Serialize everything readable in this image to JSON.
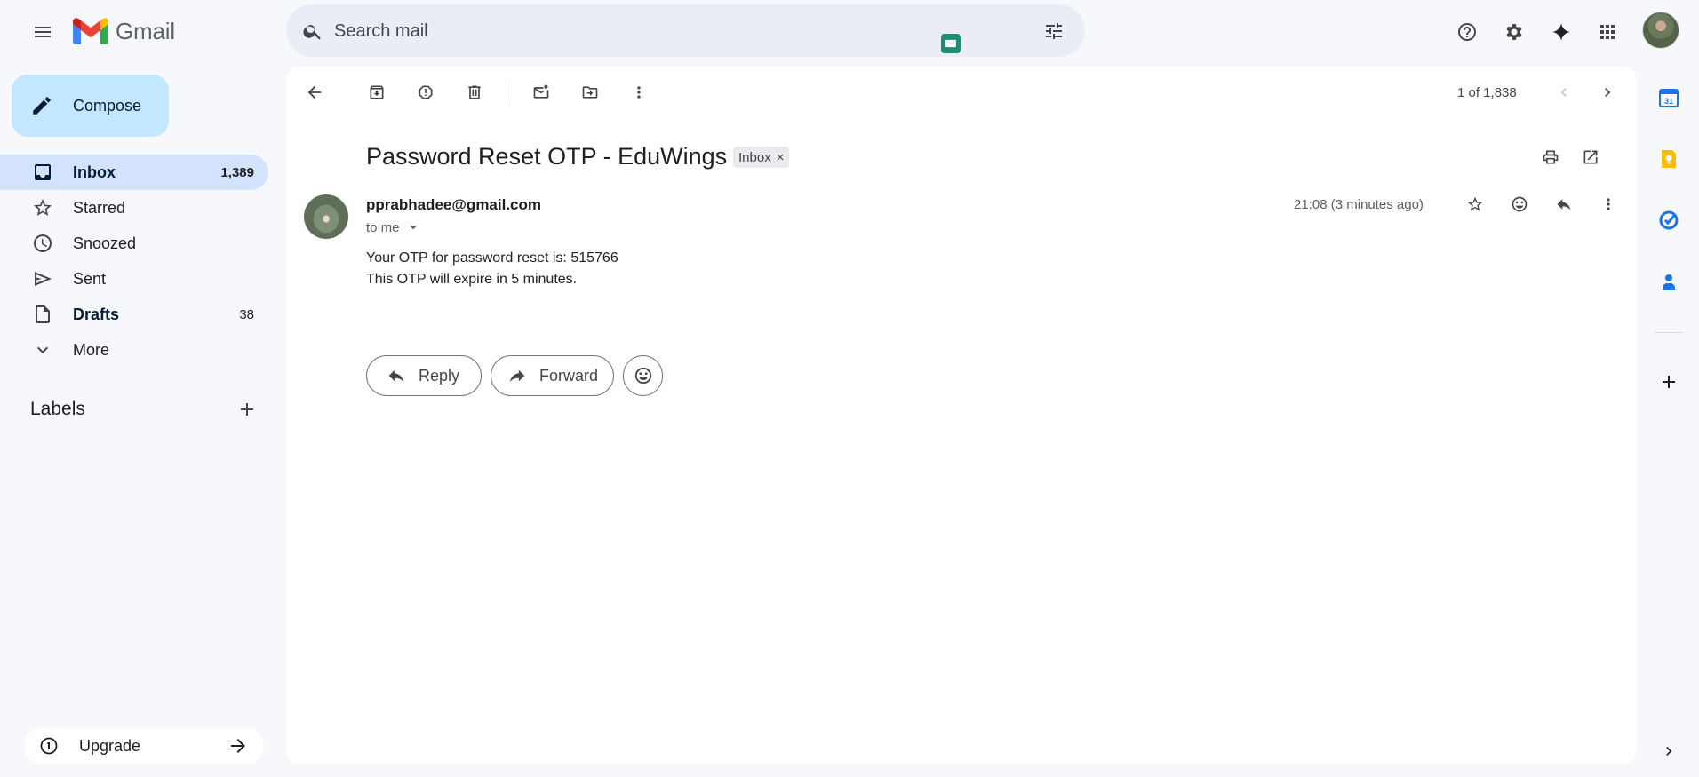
{
  "header": {
    "app_name": "Gmail",
    "search_placeholder": "Search mail"
  },
  "compose_label": "Compose",
  "nav": {
    "items": [
      {
        "label": "Inbox",
        "count": "1,389"
      },
      {
        "label": "Starred",
        "count": ""
      },
      {
        "label": "Snoozed",
        "count": ""
      },
      {
        "label": "Sent",
        "count": ""
      },
      {
        "label": "Drafts",
        "count": "38"
      },
      {
        "label": "More",
        "count": ""
      }
    ],
    "labels_title": "Labels",
    "upgrade_label": "Upgrade"
  },
  "toolbar": {
    "pager": "1 of 1,838"
  },
  "email": {
    "subject": "Password Reset OTP - EduWings",
    "chip_label": "Inbox",
    "chip_close": "×",
    "sender": "pprabhadee@gmail.com",
    "to": "to me",
    "time": "21:08 (3 minutes ago)",
    "body_line1": "Your OTP for password reset is: 515766",
    "body_line2": "This OTP will expire in 5 minutes."
  },
  "actions": {
    "reply_label": "Reply",
    "forward_label": "Forward"
  },
  "colors": {
    "page_bg": "#f6f8fc",
    "compose_bg": "#c2e7ff",
    "active_nav_bg": "#d3e3fd",
    "search_bg": "#e9eef6"
  }
}
